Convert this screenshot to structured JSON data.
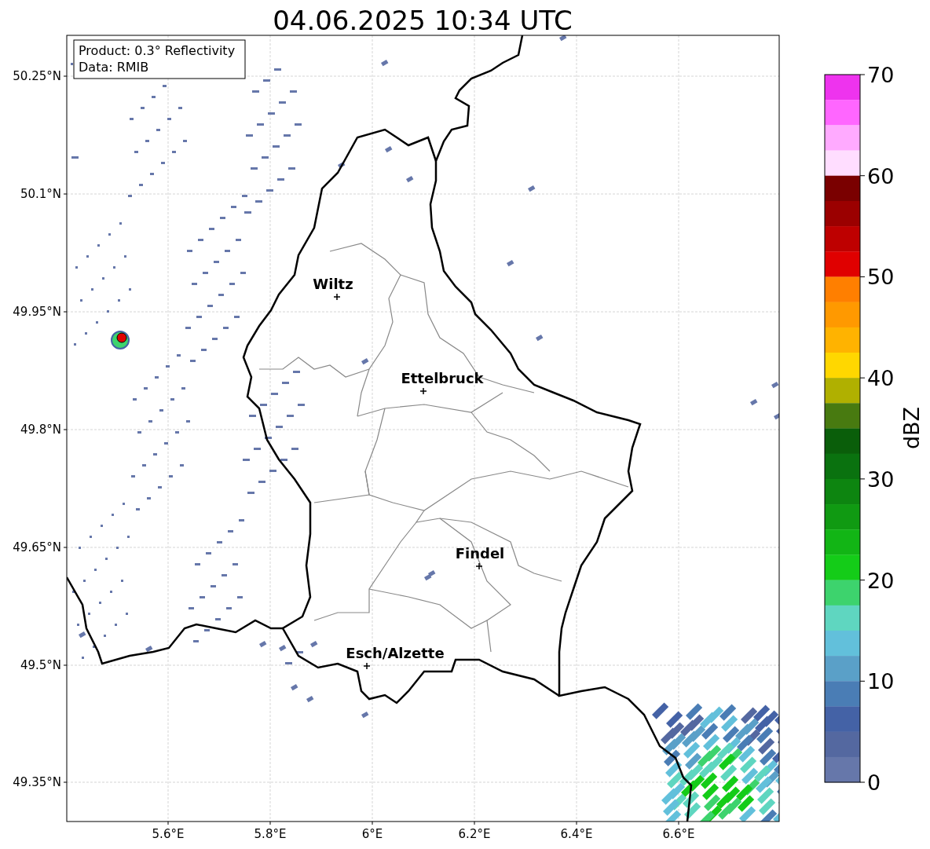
{
  "title": "04.06.2025 10:34 UTC",
  "info_box": {
    "lines": [
      "Product: 0.3° Reflectivity",
      "Data: RMIB"
    ]
  },
  "map": {
    "lat_ticks": [
      "50.25°N",
      "50.1°N",
      "49.95°N",
      "49.8°N",
      "49.65°N",
      "49.5°N",
      "49.35°N"
    ],
    "lon_ticks": [
      "5.6°E",
      "5.8°E",
      "6°E",
      "6.2°E",
      "6.4°E",
      "6.6°E"
    ],
    "cities": [
      {
        "name": "Wiltz"
      },
      {
        "name": "Ettelbruck"
      },
      {
        "name": "Findel"
      },
      {
        "name": "Esch/Alzette"
      }
    ]
  },
  "colorbar": {
    "label": "dBZ",
    "ticks": [
      "70",
      "60",
      "50",
      "40",
      "30",
      "20",
      "10",
      "0"
    ],
    "segments": [
      {
        "color": "#ee33ee"
      },
      {
        "color": "#ff66ff"
      },
      {
        "color": "#ffaaff"
      },
      {
        "color": "#ffddff"
      },
      {
        "color": "#7a0000"
      },
      {
        "color": "#9b0000"
      },
      {
        "color": "#be0000"
      },
      {
        "color": "#e00000"
      },
      {
        "color": "#ff7f00"
      },
      {
        "color": "#ff9900"
      },
      {
        "color": "#ffb300"
      },
      {
        "color": "#ffd700"
      },
      {
        "color": "#b0b000"
      },
      {
        "color": "#487a10"
      },
      {
        "color": "#0a5e0a"
      },
      {
        "color": "#0a720f"
      },
      {
        "color": "#0d8510"
      },
      {
        "color": "#109a12"
      },
      {
        "color": "#12b515"
      },
      {
        "color": "#14cc18"
      },
      {
        "color": "#3dd36d"
      },
      {
        "color": "#5fd6c0"
      },
      {
        "color": "#62c0db"
      },
      {
        "color": "#5aa0c8"
      },
      {
        "color": "#4a7db5"
      },
      {
        "color": "#4462a6"
      },
      {
        "color": "#5468a0"
      },
      {
        "color": "#6677aa"
      }
    ]
  }
}
